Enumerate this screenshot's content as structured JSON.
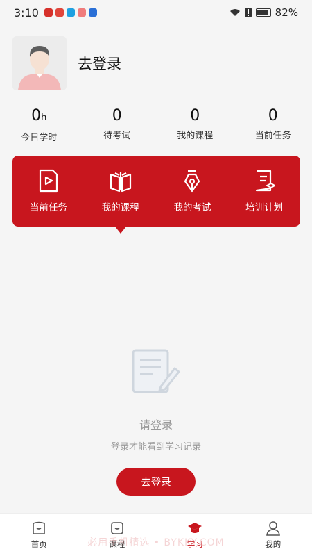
{
  "status_bar": {
    "time": "3:10",
    "battery": "82%"
  },
  "profile": {
    "title": "去登录"
  },
  "stats": [
    {
      "value": "0",
      "unit": "h",
      "label": "今日学时"
    },
    {
      "value": "0",
      "unit": "",
      "label": "待考试"
    },
    {
      "value": "0",
      "unit": "",
      "label": "我的课程"
    },
    {
      "value": "0",
      "unit": "",
      "label": "当前任务"
    }
  ],
  "quick_menu": [
    {
      "label": "当前任务",
      "icon": "video-file-icon"
    },
    {
      "label": "我的课程",
      "icon": "book-icon"
    },
    {
      "label": "我的考试",
      "icon": "pen-nib-icon"
    },
    {
      "label": "培训计划",
      "icon": "plan-document-icon"
    }
  ],
  "empty_state": {
    "title": "请登录",
    "subtitle": "登录才能看到学习记录",
    "button": "去登录"
  },
  "bottom_nav": [
    {
      "label": "首页",
      "icon": "home-icon"
    },
    {
      "label": "课程",
      "icon": "course-icon"
    },
    {
      "label": "学习",
      "icon": "graduation-cap-icon",
      "active": true
    },
    {
      "label": "我的",
      "icon": "user-icon"
    }
  ],
  "watermark": "必用手机精选 • BYKKY.COM",
  "colors": {
    "accent": "#c8161e",
    "background": "#f5f5f5"
  }
}
